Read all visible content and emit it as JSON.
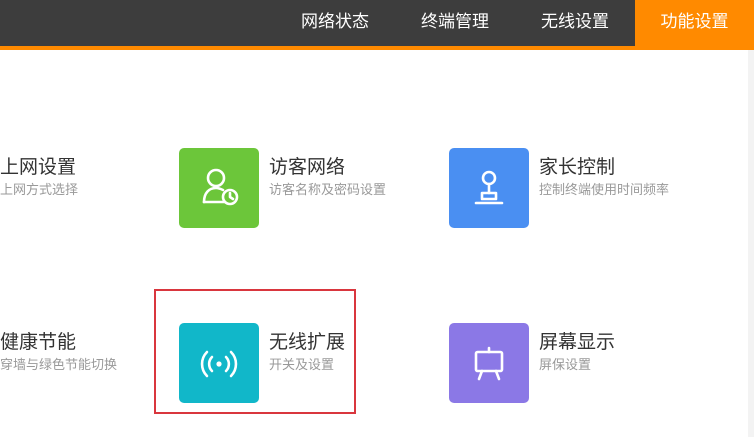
{
  "nav": {
    "tabs": [
      {
        "label": "网络状态"
      },
      {
        "label": "终端管理"
      },
      {
        "label": "无线设置"
      },
      {
        "label": "功能设置",
        "active": true
      }
    ]
  },
  "features": [
    {
      "title": "上网设置",
      "desc": "上网方式选择"
    },
    {
      "title": "访客网络",
      "desc": "访客名称及密码设置",
      "icon": "guest-user-clock-icon",
      "color": "#6cc63a"
    },
    {
      "title": "家长控制",
      "desc": "控制终端使用时间频率",
      "icon": "joystick-icon",
      "color": "#4a8ff2"
    },
    {
      "title": "健康节能",
      "desc": "穿墙与绿色节能切换"
    },
    {
      "title": "无线扩展",
      "desc": "开关及设置",
      "icon": "wireless-signal-icon",
      "color": "#11b7c9"
    },
    {
      "title": "屏幕显示",
      "desc": "屏保设置",
      "icon": "screen-easel-icon",
      "color": "#8b78e6"
    }
  ],
  "colors": {
    "nav_bg": "#3d3d3d",
    "accent": "#ff8a00",
    "highlight_border": "#d9363e"
  }
}
